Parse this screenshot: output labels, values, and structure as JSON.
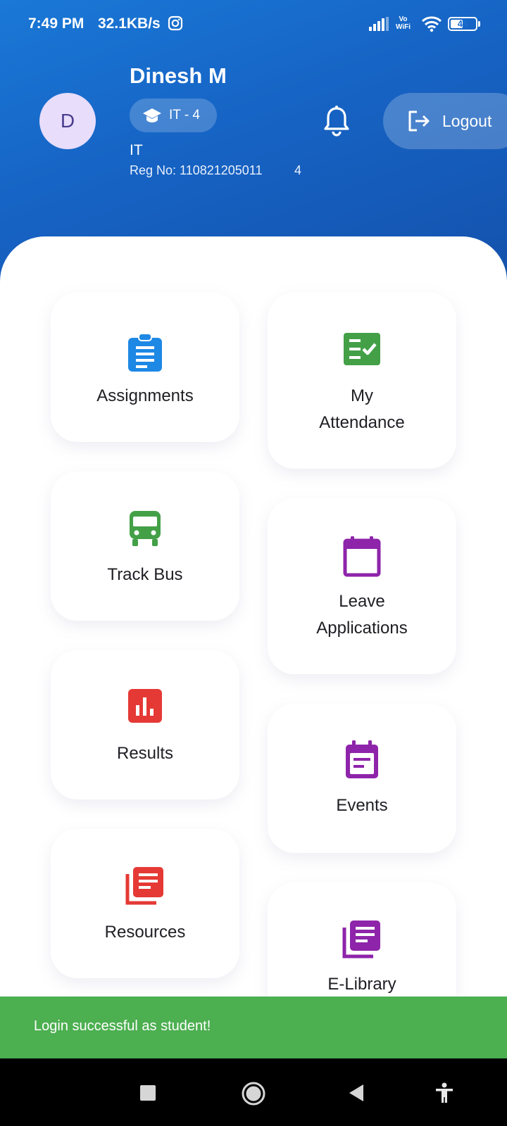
{
  "status_bar": {
    "time": "7:49 PM",
    "speed": "32.1KB/s",
    "vowifi_line1": "Vo",
    "vowifi_line2": "WiFi",
    "battery": "45"
  },
  "profile": {
    "avatar_letter": "D",
    "name": "Dinesh M",
    "chip_icon": "graduation-cap-icon",
    "chip_label": "IT - 4",
    "department": "IT",
    "reg_no": "Reg No: 110821205011",
    "semester": "4"
  },
  "header_actions": {
    "logout_label": "Logout"
  },
  "tiles": [
    {
      "label_line1": "Assignments",
      "label_line2": "",
      "icon": "clipboard-list-icon",
      "color": "#1e88e5"
    },
    {
      "label_line1": "My",
      "label_line2": "Attendance",
      "icon": "checklist-icon",
      "color": "#43a047"
    },
    {
      "label_line1": "Track Bus",
      "label_line2": "",
      "icon": "bus-icon",
      "color": "#43a047"
    },
    {
      "label_line1": "Leave",
      "label_line2": "Applications",
      "icon": "calendar-icon",
      "color": "#8e24aa"
    },
    {
      "label_line1": "Results",
      "label_line2": "",
      "icon": "bar-chart-icon",
      "color": "#e53935"
    },
    {
      "label_line1": "Events",
      "label_line2": "",
      "icon": "event-note-icon",
      "color": "#8e24aa"
    },
    {
      "label_line1": "Resources",
      "label_line2": "",
      "icon": "library-books-icon",
      "color": "#e53935"
    },
    {
      "label_line1": "E-Library",
      "label_line2": "",
      "icon": "library-books-icon",
      "color": "#8e24aa"
    }
  ],
  "snackbar": {
    "message": "Login successful as student!",
    "color": "#4caf50"
  },
  "theme": {
    "header_blue": "#1565c0",
    "accent": "#1e88e5"
  }
}
